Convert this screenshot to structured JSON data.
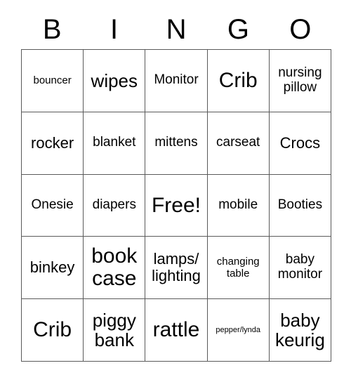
{
  "card": {
    "title_letters": [
      "B",
      "I",
      "N",
      "G",
      "O"
    ],
    "colors": {
      "background": "#ffffff",
      "text": "#000000",
      "grid_line": "#5a5a5a"
    },
    "columns": 5,
    "rows": 5,
    "free_space": {
      "row": 3,
      "column": 3,
      "label": "Free!"
    }
  },
  "grid": {
    "rows": [
      {
        "cells": [
          {
            "label": "bouncer",
            "size": "sm"
          },
          {
            "label": "wipes",
            "size": "xl"
          },
          {
            "label": "Monitor",
            "size": "md"
          },
          {
            "label": "Crib",
            "size": "xxl"
          },
          {
            "label": "nursing pillow",
            "size": "md"
          }
        ]
      },
      {
        "cells": [
          {
            "label": "rocker",
            "size": "lg"
          },
          {
            "label": "blanket",
            "size": "md"
          },
          {
            "label": "mittens",
            "size": "md"
          },
          {
            "label": "carseat",
            "size": "md"
          },
          {
            "label": "Crocs",
            "size": "lg"
          }
        ]
      },
      {
        "cells": [
          {
            "label": "Onesie",
            "size": "md"
          },
          {
            "label": "diapers",
            "size": "md"
          },
          {
            "label": "Free!",
            "size": "xxl"
          },
          {
            "label": "mobile",
            "size": "md"
          },
          {
            "label": "Booties",
            "size": "md"
          }
        ]
      },
      {
        "cells": [
          {
            "label": "binkey",
            "size": "lg"
          },
          {
            "label": "book case",
            "size": "xxl"
          },
          {
            "label": "lamps/ lighting",
            "size": "lg"
          },
          {
            "label": "changing table",
            "size": "sm"
          },
          {
            "label": "baby monitor",
            "size": "md"
          }
        ]
      },
      {
        "cells": [
          {
            "label": "Crib",
            "size": "xxl"
          },
          {
            "label": "piggy bank",
            "size": "xl"
          },
          {
            "label": "rattle",
            "size": "xxl"
          },
          {
            "label": "pepper/lynda",
            "size": "xs"
          },
          {
            "label": "baby keurig",
            "size": "xl"
          }
        ]
      }
    ]
  }
}
